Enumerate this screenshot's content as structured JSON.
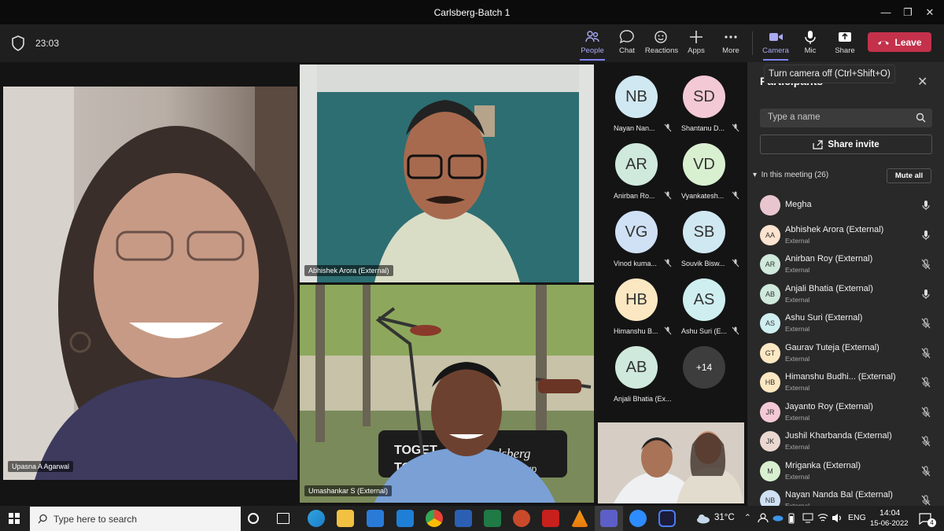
{
  "window": {
    "title": "Carlsberg-Batch 1",
    "minimize": "—",
    "restore": "❐",
    "close": "✕"
  },
  "toolbar": {
    "timer": "23:03",
    "buttons": {
      "people": "People",
      "chat": "Chat",
      "reactions": "Reactions",
      "apps": "Apps",
      "more": "More",
      "camera": "Camera",
      "mic": "Mic",
      "share": "Share"
    },
    "leave": "Leave",
    "tooltip": "Turn camera off (Ctrl+Shift+O)"
  },
  "videos": {
    "upasna": "Upasna A Agarwal",
    "abhishek": "Abhishek Arora (External)",
    "umashankar": "Umashankar S (External)",
    "sign_line1": "TOGET",
    "sign_line2": "TOWA",
    "sign_brand": "rlsberg",
    "sign_group": "Group"
  },
  "tiles": [
    {
      "initials": "NB",
      "name": "Nayan Nan...",
      "color": "#d0e8f2"
    },
    {
      "initials": "SD",
      "name": "Shantanu D...",
      "color": "#f4c9d6"
    },
    {
      "initials": "AR",
      "name": "Anirban Ro...",
      "color": "#cfe9dc"
    },
    {
      "initials": "VD",
      "name": "Vyankatesh...",
      "color": "#d9f0d0"
    },
    {
      "initials": "VG",
      "name": "Vinod kuma...",
      "color": "#d0e1f5"
    },
    {
      "initials": "SB",
      "name": "Souvik Bisw...",
      "color": "#d0e8f2"
    },
    {
      "initials": "HB",
      "name": "Himanshu B...",
      "color": "#fbe8c2"
    },
    {
      "initials": "AS",
      "name": "Ashu Suri (E...",
      "color": "#cfeef0"
    },
    {
      "initials": "AB",
      "name": "Anjali Bhatia (Ex...",
      "color": "#cfe9dc"
    }
  ],
  "overflow": "+14",
  "panel": {
    "title": "Participants",
    "search_placeholder": "Type a name",
    "share_invite": "Share invite",
    "in_meeting": "In this meeting (26)",
    "mute_all": "Mute all",
    "participants": [
      {
        "initials": "",
        "name": "Megha",
        "role": "",
        "muted": false,
        "color": "#e9c6cf"
      },
      {
        "initials": "AA",
        "name": "Abhishek Arora (External)",
        "role": "External",
        "muted": false,
        "color": "#fbe3cf"
      },
      {
        "initials": "AR",
        "name": "Anirban Roy (External)",
        "role": "External",
        "muted": true,
        "color": "#cfe9dc"
      },
      {
        "initials": "AB",
        "name": "Anjali Bhatia (External)",
        "role": "External",
        "muted": false,
        "color": "#cfe9dc"
      },
      {
        "initials": "AS",
        "name": "Ashu Suri (External)",
        "role": "External",
        "muted": true,
        "color": "#cfeef0"
      },
      {
        "initials": "GT",
        "name": "Gaurav Tuteja (External)",
        "role": "External",
        "muted": true,
        "color": "#fbe8c2"
      },
      {
        "initials": "HB",
        "name": "Himanshu Budhi... (External)",
        "role": "External",
        "muted": true,
        "color": "#fbe8c2"
      },
      {
        "initials": "JR",
        "name": "Jayanto Roy (External)",
        "role": "External",
        "muted": true,
        "color": "#f4c9d6"
      },
      {
        "initials": "JK",
        "name": "Jushil Kharbanda (External)",
        "role": "External",
        "muted": true,
        "color": "#ead8d0"
      },
      {
        "initials": "M",
        "name": "Mriganka (External)",
        "role": "External",
        "muted": true,
        "color": "#d9f0d0"
      },
      {
        "initials": "NB",
        "name": "Nayan Nanda Bal (External)",
        "role": "External",
        "muted": true,
        "color": "#d0e1f5"
      }
    ]
  },
  "taskbar": {
    "search": "Type here to search",
    "weather": "31°C",
    "lang": "ENG",
    "time": "14:04",
    "date": "15-06-2022",
    "notifications": "4"
  }
}
